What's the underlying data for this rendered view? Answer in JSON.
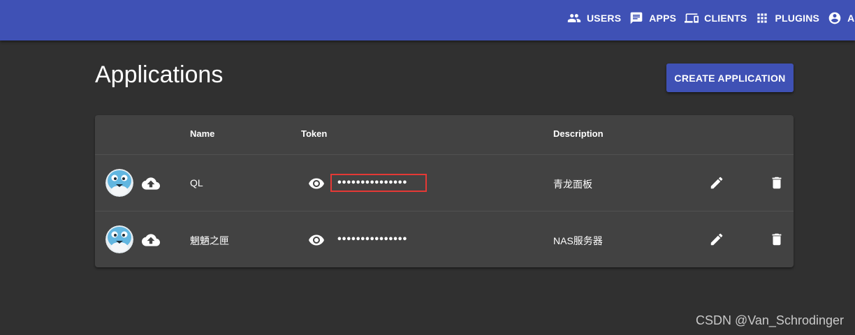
{
  "nav": {
    "users": "USERS",
    "apps": "APPS",
    "clients": "CLIENTS",
    "plugins": "PLUGINS",
    "admin": "ADM"
  },
  "page": {
    "title": "Applications",
    "create_label": "CREATE APPLICATION"
  },
  "table": {
    "headers": {
      "name": "Name",
      "token": "Token",
      "description": "Description"
    },
    "rows": [
      {
        "name": "QL",
        "token": "•••••••••••••••",
        "description": "青龙面板",
        "highlighted": true
      },
      {
        "name": "魍魉之匣",
        "token": "•••••••••••••••",
        "description": "NAS服务器",
        "highlighted": false
      }
    ]
  },
  "watermark": "CSDN @Van_Schrodinger",
  "colors": {
    "primary": "#3f51b5",
    "background": "#303030",
    "card": "#424242",
    "highlight_border": "#e53935"
  },
  "icons": [
    "users-icon",
    "apps-icon",
    "clients-icon",
    "plugins-icon",
    "admin-icon",
    "app-avatar-icon",
    "upload-icon",
    "eye-icon",
    "edit-icon",
    "delete-icon"
  ]
}
